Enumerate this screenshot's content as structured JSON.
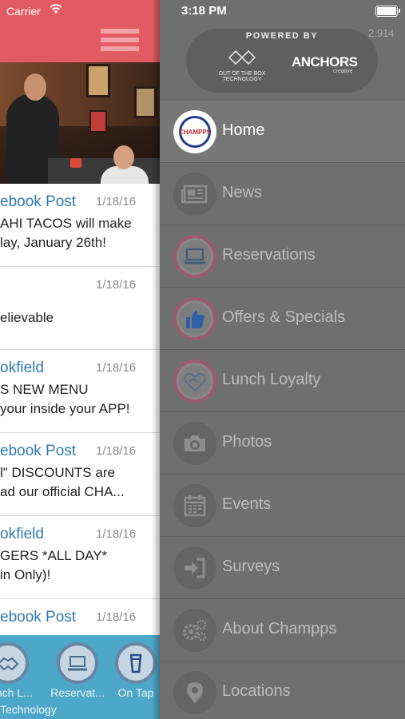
{
  "app": {
    "status": {
      "carrier": "Carrier"
    },
    "feed": [
      {
        "title": "ebook Post",
        "date": "1/18/16",
        "line1": "AHI TACOS will make",
        "line2": "lay, January 26th!"
      },
      {
        "title": "",
        "date": "1/18/16",
        "line1": "elievable",
        "line2": ""
      },
      {
        "title": "okfield",
        "date": "1/18/16",
        "line1": "S NEW MENU",
        "line2": " your inside your APP!"
      },
      {
        "title": "ebook Post",
        "date": "1/18/16",
        "line1": "l\" DISCOUNTS are",
        "line2": "ad our official CHA..."
      },
      {
        "title": "okfield",
        "date": "1/18/16",
        "line1": "GERS *ALL DAY*",
        "line2": "in Only)!"
      },
      {
        "title": "ebook Post",
        "date": "1/18/16",
        "line1": "",
        "line2": ""
      }
    ],
    "tabs": [
      {
        "label": "Lunch L...",
        "icon": "handshake-icon"
      },
      {
        "label": "Reservat...",
        "icon": "laptop-icon"
      },
      {
        "label": "On Tap",
        "icon": "beer-glass-icon"
      }
    ],
    "footer": "Technology"
  },
  "drawer": {
    "status": {
      "time": "3:18 PM",
      "battery_level": 1.0
    },
    "powered_by": {
      "label": "POWERED BY",
      "ootb_line": "OUT OF THE BOX",
      "ootb_sub": "TECHNOLOGY",
      "anchors": "ANCHORS",
      "creative": "creative"
    },
    "version": "2.914",
    "menu": [
      {
        "label": "Home",
        "icon": "champps-logo-icon",
        "active": true,
        "logo_text": "CHAMPPS"
      },
      {
        "label": "News",
        "icon": "newspaper-icon"
      },
      {
        "label": "Reservations",
        "icon": "laptop-icon"
      },
      {
        "label": "Offers & Specials",
        "icon": "thumbs-up-icon"
      },
      {
        "label": "Lunch Loyalty",
        "icon": "handshake-icon"
      },
      {
        "label": "Photos",
        "icon": "camera-icon"
      },
      {
        "label": "Events",
        "icon": "calendar-icon"
      },
      {
        "label": "Surveys",
        "icon": "sign-in-icon"
      },
      {
        "label": "About Champps",
        "icon": "gears-icon"
      },
      {
        "label": "Locations",
        "icon": "map-pin-icon"
      }
    ],
    "colors": {
      "drawer_bg": "#6f6f6f",
      "active_row": "#777777",
      "header_red": "#e35b62",
      "tabbar_blue": "#4da7c9",
      "link_blue": "#2f7ab6"
    }
  }
}
